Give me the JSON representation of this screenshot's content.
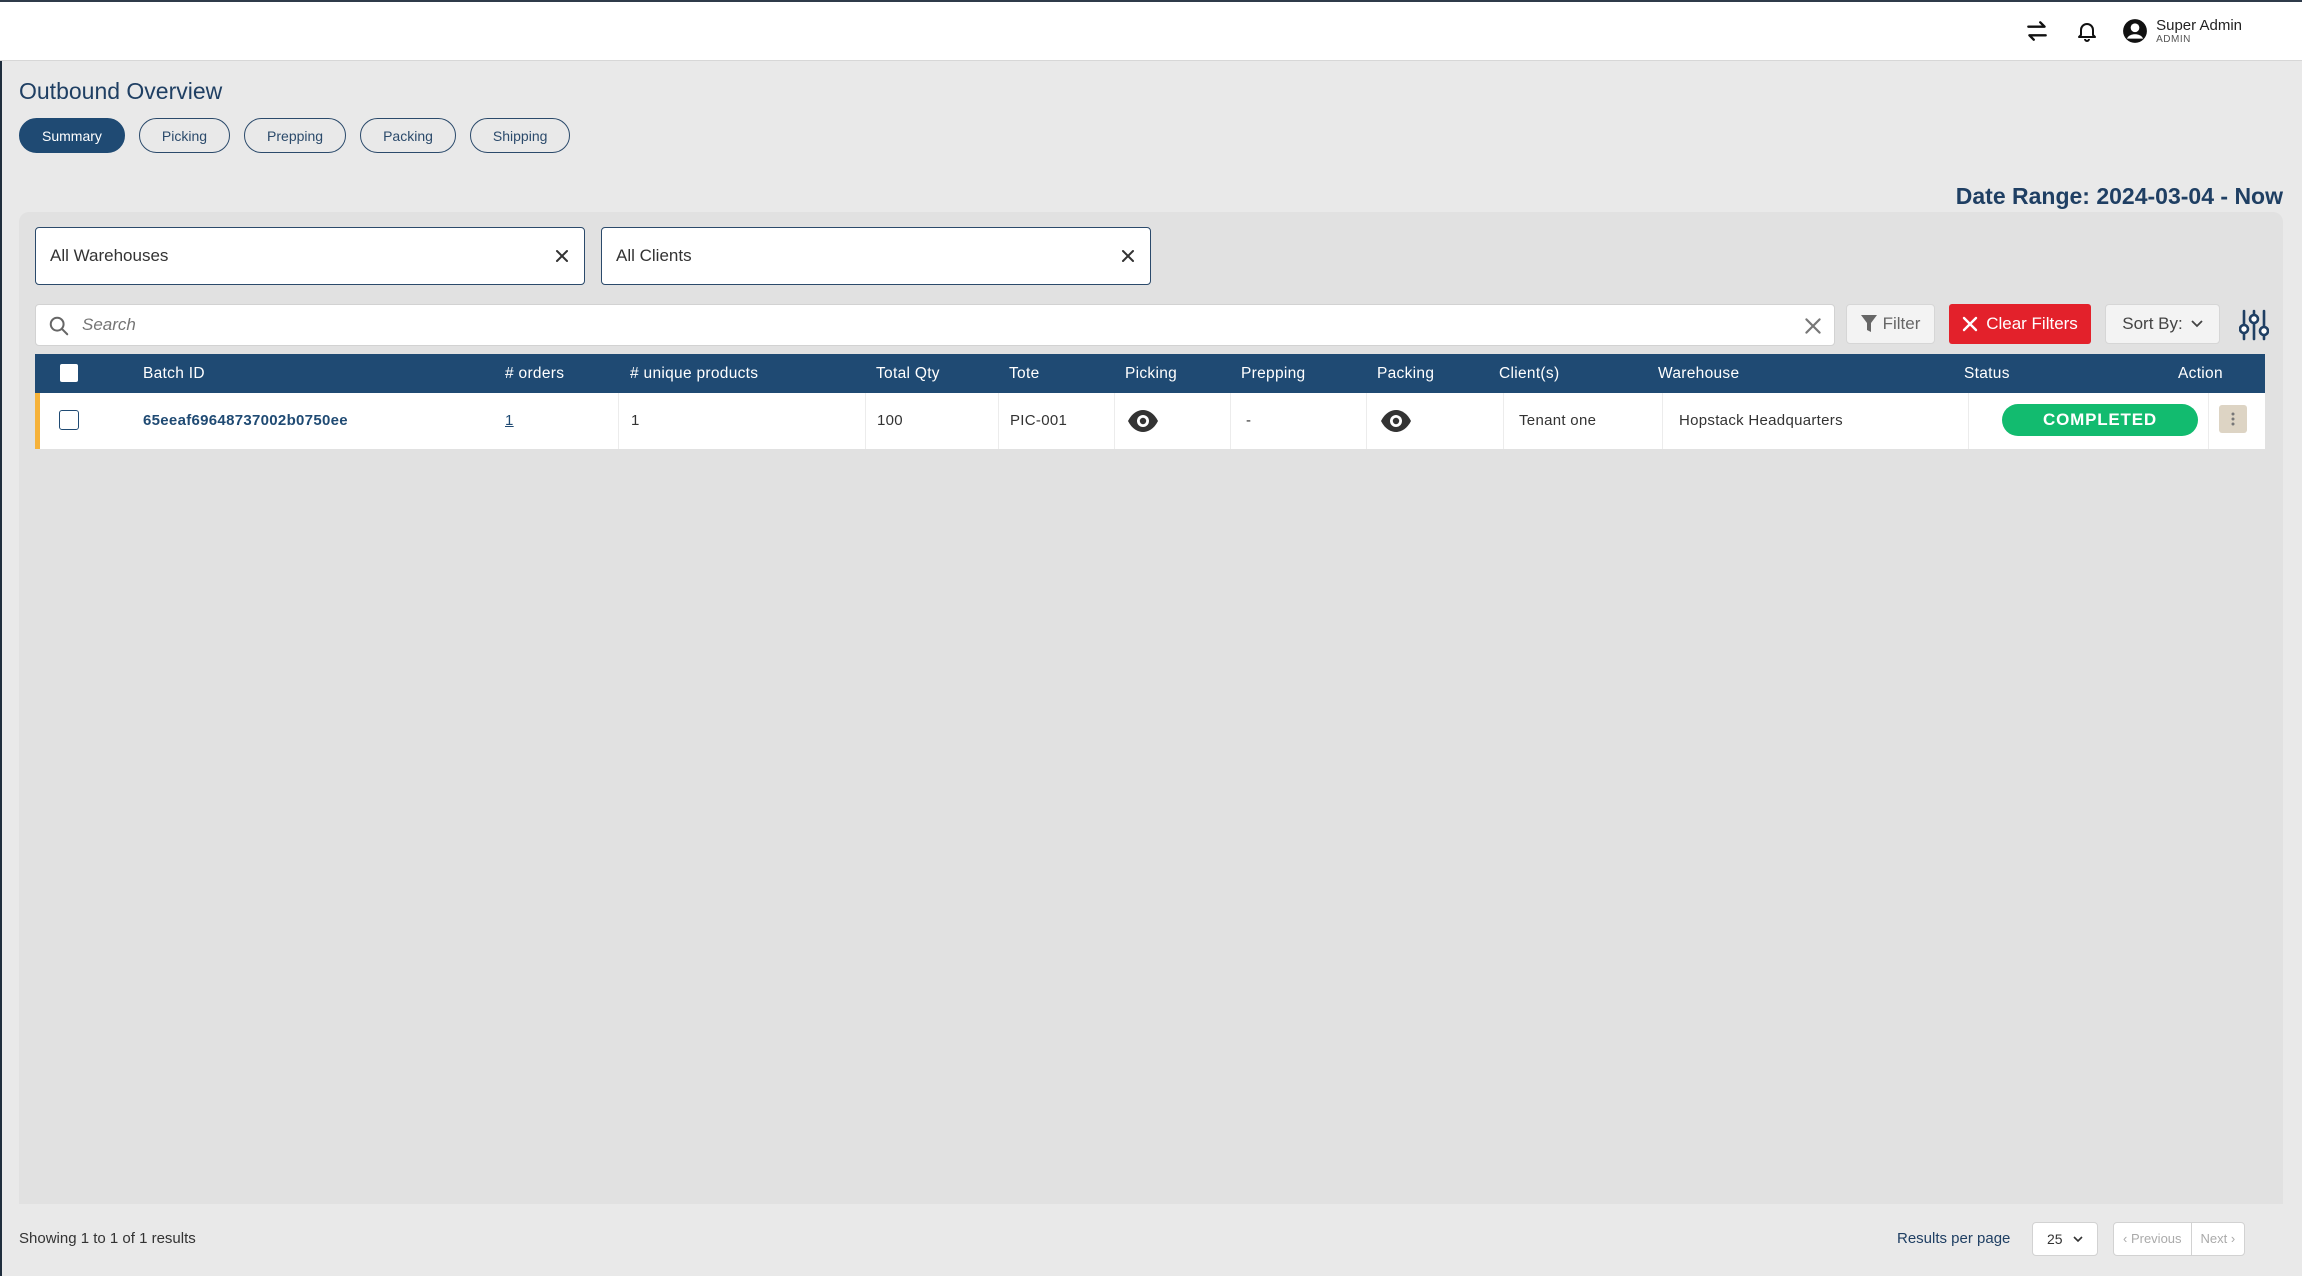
{
  "header": {
    "user_name": "Super Admin",
    "user_role": "ADMIN",
    "icons": [
      "switch-icon",
      "bell-icon",
      "user-circle-icon"
    ]
  },
  "page": {
    "title": "Outbound Overview",
    "tabs": [
      {
        "label": "Summary",
        "active": true
      },
      {
        "label": "Picking",
        "active": false
      },
      {
        "label": "Prepping",
        "active": false
      },
      {
        "label": "Packing",
        "active": false
      },
      {
        "label": "Shipping",
        "active": false
      }
    ],
    "date_range": "Date Range: 2024-03-04 - Now"
  },
  "filters": {
    "warehouse": "All Warehouses",
    "client": "All Clients",
    "search_placeholder": "Search",
    "filter_label": "Filter",
    "clear_label": "Clear Filters",
    "sort_label": "Sort By:"
  },
  "table": {
    "columns": [
      "Batch ID",
      "# orders",
      "# unique products",
      "Total Qty",
      "Tote",
      "Picking",
      "Prepping",
      "Packing",
      "Client(s)",
      "Warehouse",
      "Status",
      "Action"
    ],
    "rows": [
      {
        "batch_id": "65eeaf69648737002b0750ee",
        "orders": "1",
        "unique_products": "1",
        "total_qty": "100",
        "tote": "PIC-001",
        "picking": "eye-icon",
        "prepping": "-",
        "packing": "eye-icon",
        "clients": "Tenant one",
        "warehouse": "Hopstack Headquarters",
        "status": "COMPLETED",
        "status_color": "#12bb6f"
      }
    ]
  },
  "footer": {
    "showing": "Showing 1 to 1 of 1 results",
    "results_per_page_label": "Results per page",
    "per_page": "25",
    "previous": "Previous",
    "next": "Next"
  },
  "colors": {
    "primary": "#1f4a73",
    "danger": "#e3212b",
    "success": "#12bb6f",
    "row_accent": "#f6b23a"
  }
}
